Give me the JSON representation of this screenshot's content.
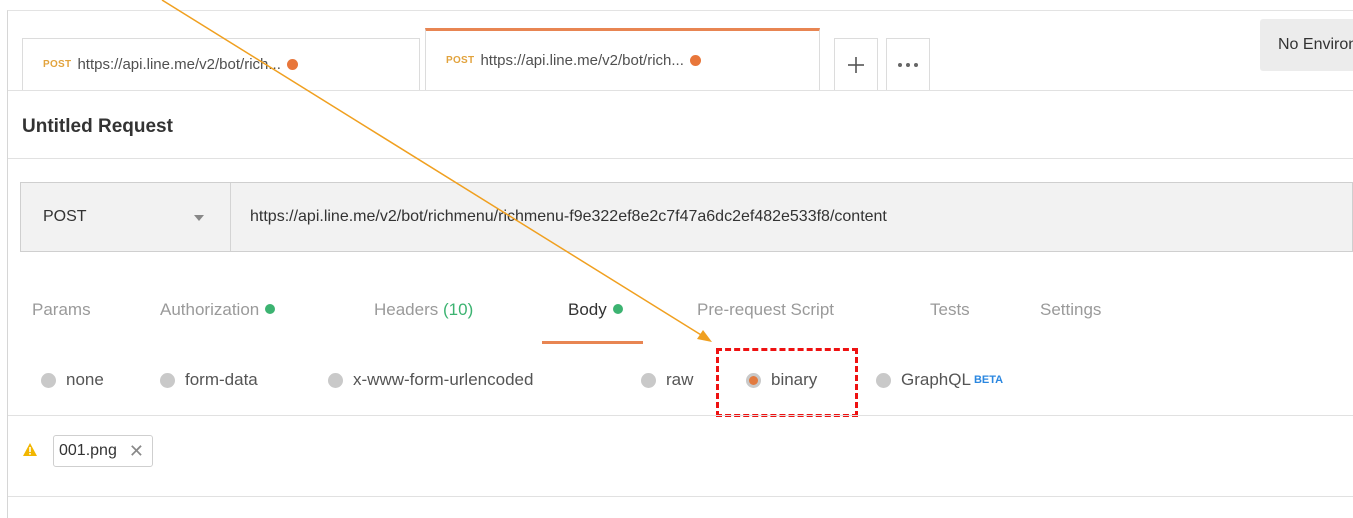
{
  "tabs": [
    {
      "method": "POST",
      "url": "https://api.line.me/v2/bot/rich..."
    },
    {
      "method": "POST",
      "url": "https://api.line.me/v2/bot/rich..."
    }
  ],
  "toolbar": {
    "add_icon": "plus-icon",
    "more_icon": "ellipsis-icon"
  },
  "environment": {
    "label": "No Environment"
  },
  "request": {
    "title": "Untitled Request",
    "method": "POST",
    "url": "https://api.line.me/v2/bot/richmenu/richmenu-f9e322ef8e2c7f47a6dc2ef482e533f8/content"
  },
  "request_tabs": {
    "params": "Params",
    "authorization": "Authorization",
    "headers": "Headers",
    "headers_count": "(10)",
    "body": "Body",
    "prerequest": "Pre-request Script",
    "tests": "Tests",
    "settings": "Settings"
  },
  "body_modes": {
    "none": "none",
    "form_data": "form-data",
    "urlencoded": "x-www-form-urlencoded",
    "raw": "raw",
    "binary": "binary",
    "graphql": "GraphQL",
    "beta": "BETA",
    "selected": "binary"
  },
  "file": {
    "name": "001.png",
    "remove_glyph": "✕"
  },
  "colors": {
    "accent": "#e88552",
    "method_post": "#e2a33d",
    "unsaved_dot": "#e8763a",
    "status_green": "#3cb371",
    "beta_blue": "#2b87e0",
    "annotation_red": "#e11111",
    "annotation_arrow": "#f0a020"
  }
}
